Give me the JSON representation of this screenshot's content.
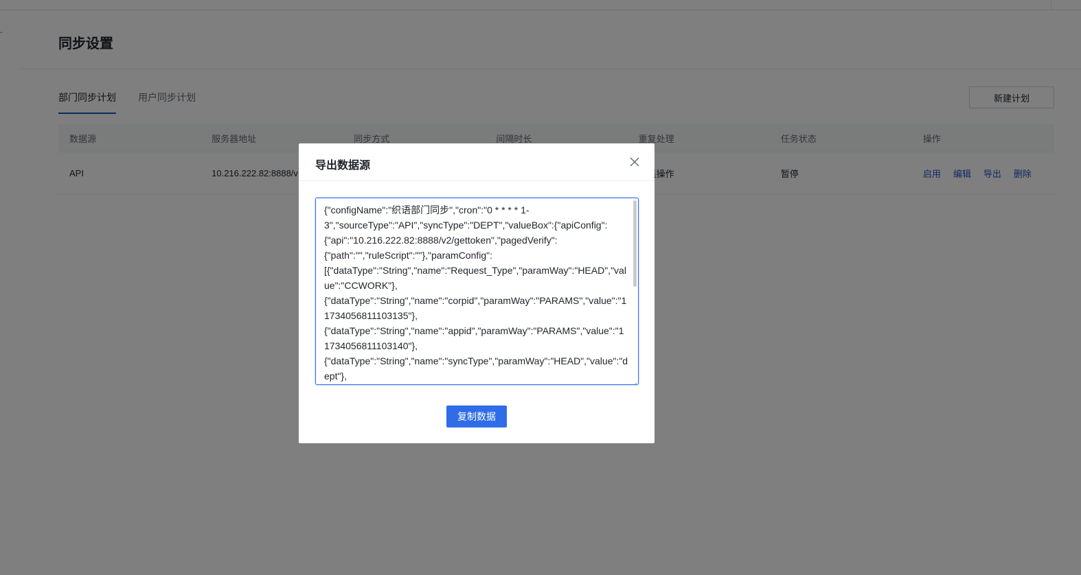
{
  "page": {
    "title": "同步设置",
    "collapse_mark": "ˇ"
  },
  "tabs": [
    {
      "label": "部门同步计划",
      "active": true
    },
    {
      "label": "用户同步计划",
      "active": false
    }
  ],
  "toolbar": {
    "new_plan_label": "新建计划"
  },
  "table": {
    "headers": [
      "数据源",
      "服务器地址",
      "同步方式",
      "间隔时长",
      "重复处理",
      "任务状态",
      "操作"
    ],
    "rows": [
      {
        "source": "API",
        "server": "10.216.222.82:8888/v",
        "sync_mode": "",
        "interval": "",
        "repeat": "覆盖操作",
        "status": "暂停",
        "actions": [
          "启用",
          "编辑",
          "导出",
          "删除"
        ]
      }
    ]
  },
  "modal": {
    "title": "导出数据源",
    "close_icon": "close-icon",
    "json_text": "{\"configName\":\"织语部门同步\",\"cron\":\"0 * * * * 1-3\",\"sourceType\":\"API\",\"syncType\":\"DEPT\",\"valueBox\":{\"apiConfig\":{\"api\":\"10.216.222.82:8888/v2/gettoken\",\"pagedVerify\":{\"path\":\"\",\"ruleScript\":\"\"},\"paramConfig\":[{\"dataType\":\"String\",\"name\":\"Request_Type\",\"paramWay\":\"HEAD\",\"value\":\"CCWORK\"},{\"dataType\":\"String\",\"name\":\"corpid\",\"paramWay\":\"PARAMS\",\"value\":\"11734056811103135\"},{\"dataType\":\"String\",\"name\":\"appid\",\"paramWay\":\"PARAMS\",\"value\":\"11734056811103140\"},{\"dataType\":\"String\",\"name\":\"syncType\",\"paramWay\":\"HEAD\",\"value\":\"dept\"},",
    "copy_label": "复制数据"
  },
  "colors": {
    "accent": "#1f56c2",
    "primary_button": "#2e6ce8",
    "focus_border": "#3370ff",
    "overlay": "rgba(0,0,0,0.5)"
  }
}
